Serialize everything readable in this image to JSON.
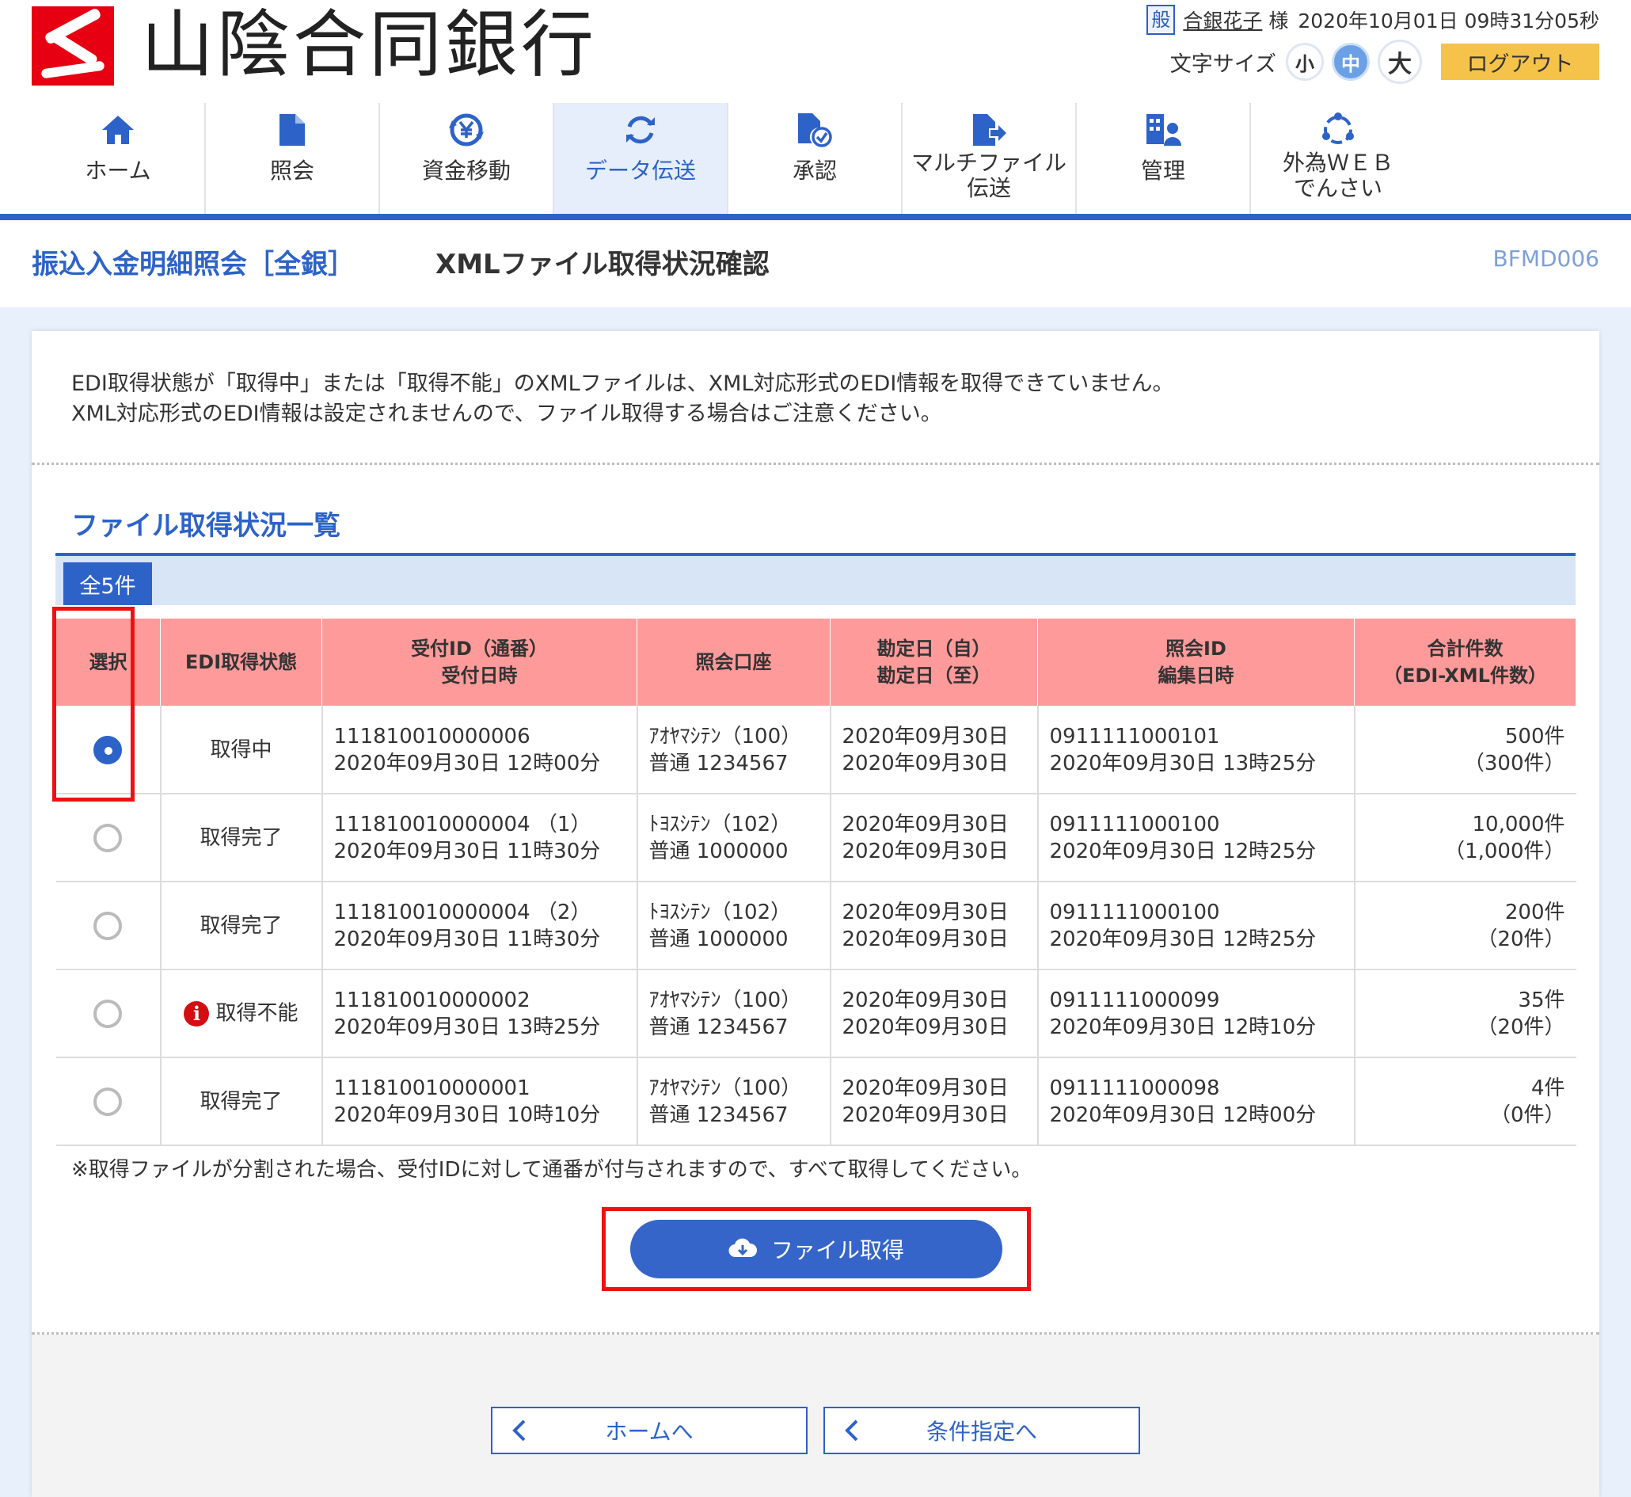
{
  "header": {
    "logo_text": "山陰合同銀行",
    "user_badge": "般",
    "user_name": "合銀花子",
    "user_suffix": "様",
    "datetime": "2020年10月01日 09時31分05秒",
    "font_size_label": "文字サイズ",
    "font_small": "小",
    "font_medium": "中",
    "font_large": "大",
    "logout_label": "ログアウト"
  },
  "nav": {
    "items": [
      {
        "label": "ホーム",
        "icon": "home-icon"
      },
      {
        "label": "照会",
        "icon": "document-icon"
      },
      {
        "label": "資金移動",
        "icon": "yen-transfer-icon"
      },
      {
        "label": "データ伝送",
        "icon": "refresh-icon",
        "active": true
      },
      {
        "label": "承認",
        "icon": "approval-icon"
      },
      {
        "label": "マルチファイル\n伝送",
        "icon": "file-transfer-icon"
      },
      {
        "label": "管理",
        "icon": "admin-icon"
      },
      {
        "label": "外為ＷＥＢ\nでんさい",
        "icon": "foreign-exchange-icon"
      }
    ],
    "active_color": "#2d63c8"
  },
  "page": {
    "title": "振込入金明細照会［全銀］",
    "subtitle": "XMLファイル取得状況確認",
    "screen_code": "BFMD006"
  },
  "notice": {
    "line1": "EDI取得状態が「取得中」または「取得不能」のXMLファイルは、XML対応形式のEDI情報を取得できていません。",
    "line2": "XML対応形式のEDI情報は設定されませんので、ファイル取得する場合はご注意ください。"
  },
  "list": {
    "section_title": "ファイル取得状況一覧",
    "count_label": "全5件",
    "headers": [
      "選択",
      "EDI取得状態",
      "受付ID（通番）\n受付日時",
      "照会口座",
      "勘定日（自）\n勘定日（至）",
      "照会ID\n編集日時",
      "合計件数\n（EDI-XML件数）"
    ],
    "rows": [
      {
        "selected": true,
        "status": "取得中",
        "error": false,
        "accept_id": "111810010000006",
        "accept_dt": "2020年09月30日 12時00分",
        "account_name": "ｱｵﾔﾏｼﾃﾝ（100）",
        "account_no": "普通 1234567",
        "date_from": "2020年09月30日",
        "date_to": "2020年09月30日",
        "query_id": "0911111000101",
        "edit_dt": "2020年09月30日 13時25分",
        "total": "500件",
        "xml_count": "（300件）"
      },
      {
        "selected": false,
        "status": "取得完了",
        "error": false,
        "accept_id": "111810010000004 （1）",
        "accept_dt": "2020年09月30日 11時30分",
        "account_name": "ﾄﾖｽｼﾃﾝ（102）",
        "account_no": "普通 1000000",
        "date_from": "2020年09月30日",
        "date_to": "2020年09月30日",
        "query_id": "0911111000100",
        "edit_dt": "2020年09月30日 12時25分",
        "total": "10,000件",
        "xml_count": "（1,000件）"
      },
      {
        "selected": false,
        "status": "取得完了",
        "error": false,
        "accept_id": "111810010000004 （2）",
        "accept_dt": "2020年09月30日 11時30分",
        "account_name": "ﾄﾖｽｼﾃﾝ（102）",
        "account_no": "普通 1000000",
        "date_from": "2020年09月30日",
        "date_to": "2020年09月30日",
        "query_id": "0911111000100",
        "edit_dt": "2020年09月30日 12時25分",
        "total": "200件",
        "xml_count": "（20件）"
      },
      {
        "selected": false,
        "status": "取得不能",
        "error": true,
        "accept_id": "111810010000002",
        "accept_dt": "2020年09月30日 13時25分",
        "account_name": "ｱｵﾔﾏｼﾃﾝ（100）",
        "account_no": "普通 1234567",
        "date_from": "2020年09月30日",
        "date_to": "2020年09月30日",
        "query_id": "0911111000099",
        "edit_dt": "2020年09月30日 12時10分",
        "total": "35件",
        "xml_count": "（20件）"
      },
      {
        "selected": false,
        "status": "取得完了",
        "error": false,
        "accept_id": "111810010000001",
        "accept_dt": "2020年09月30日 10時10分",
        "account_name": "ｱｵﾔﾏｼﾃﾝ（100）",
        "account_no": "普通 1234567",
        "date_from": "2020年09月30日",
        "date_to": "2020年09月30日",
        "query_id": "0911111000098",
        "edit_dt": "2020年09月30日 12時00分",
        "total": "4件",
        "xml_count": "（0件）"
      }
    ],
    "footnote": "※取得ファイルが分割された場合、受付IDに対して通番が付与されますので、すべて取得してください。",
    "header_color": "#ff9a9a"
  },
  "actions": {
    "download_label": "ファイル取得",
    "download_icon": "cloud-download-icon",
    "home_label": "ホームへ",
    "condition_label": "条件指定へ",
    "highlight_color": "#ee1111"
  }
}
